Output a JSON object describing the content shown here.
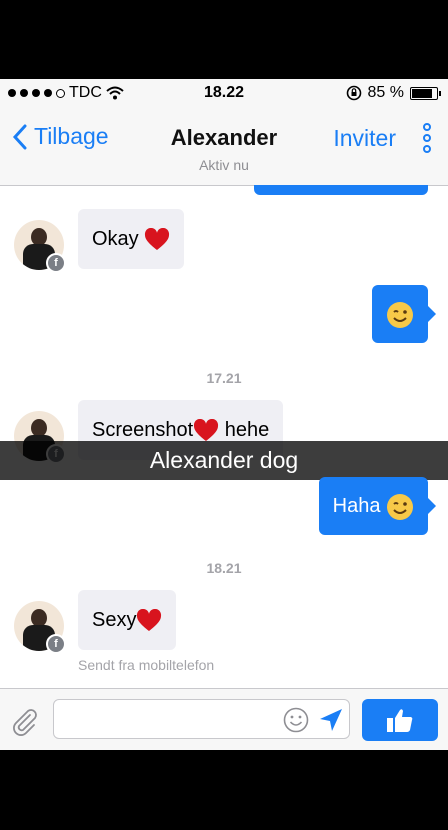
{
  "status": {
    "carrier": "TDC",
    "time": "18.22",
    "battery": "85 %",
    "battery_level": 0.85
  },
  "nav": {
    "back_label": "Tilbage",
    "title": "Alexander",
    "subtitle": "Aktiv nu",
    "invite_label": "Inviter"
  },
  "messages": [
    {
      "text": "Okay"
    },
    {
      "text": ""
    },
    {
      "timestamp": "17.21"
    },
    {
      "text": "Screenshot",
      "after": "hehe"
    },
    {
      "text": "Haha"
    },
    {
      "timestamp": "18.21"
    },
    {
      "text": "Sexy"
    }
  ],
  "overlay_caption": "Alexander dog",
  "sent_note": "Sendt fra mobiltelefon",
  "icons": {
    "fb_badge": "f"
  },
  "colors": {
    "accent": "#1a7ef5",
    "incoming": "#efeff4"
  }
}
